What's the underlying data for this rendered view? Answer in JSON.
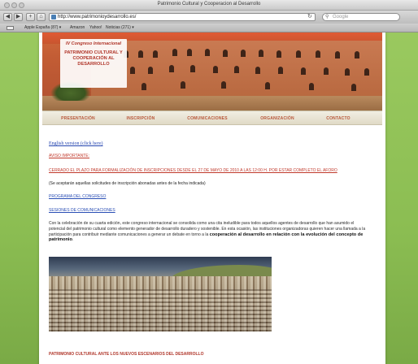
{
  "window": {
    "title": "Patrimonio Cultural y Cooperacion al Desarrollo"
  },
  "toolbar": {
    "back": "◀",
    "forward": "▶",
    "add": "+",
    "url": "http://www.patrimonioydesarrollo.es/",
    "search_placeholder": "Google"
  },
  "bookmarks": {
    "items": [
      "Apple España (87) ▾",
      "Amazon",
      "Yahoo!",
      "Noticias (271) ▾"
    ]
  },
  "banner": {
    "edition": "IV Congreso Internacional",
    "title": "PATRIMONIO CULTURAL Y COOPERACIÓN AL DESARROLLO"
  },
  "nav": {
    "items": [
      "PRESENTACIÓN",
      "INSCRIPCIÓN",
      "COMUNICACIONES",
      "ORGANIZACIÓN",
      "CONTACTO"
    ]
  },
  "content": {
    "english_link": "English version (click here)",
    "notice_title": "AVISO IMPORTANTE:",
    "notice_text": "CERRADO EL PLAZO PARA FORMALIZACIÓN DE INSCRIPCIONES DESDE EL 27 DE MAYO DE 2010 A LAS 12:00 H. POR ESTAR COMPLETO EL AFORO",
    "note": "(Se aceptarán aquellas solicitudes de inscripción abonadas antes de la fecha indicada)",
    "programa_link": "PROGRAMA DEL CONGRESO",
    "sesiones_link": "SESIONES DE COMUNICACIONES",
    "paragraph": "Con la celebración de su cuarta edición, este congreso internacional se consolida como una cita ineludible para todos aquellos agentes de desarrollo que han asumido el potencial del patrimonio cultural como elemento generador de desarrollo duradero y sostenible. En esta ocasión, las instituciones organizadoras quieren hacer una llamada a la participación para contribuir mediante comunicaciones a generar un debate en torno a la",
    "paragraph_bold": "cooperación al desarrollo en relación con la evolución del concepto de patrimonio",
    "paragraph_end": ".",
    "section_title": "PATRIMONIO CULTURAL ANTE LOS NUEVOS ESCENARIOS DEL DESARROLLO"
  },
  "colors": {
    "accent_red": "#b0362a",
    "nav_text": "#b8573a",
    "link_blue": "#2646b0",
    "background_green": "#8fbf55"
  }
}
